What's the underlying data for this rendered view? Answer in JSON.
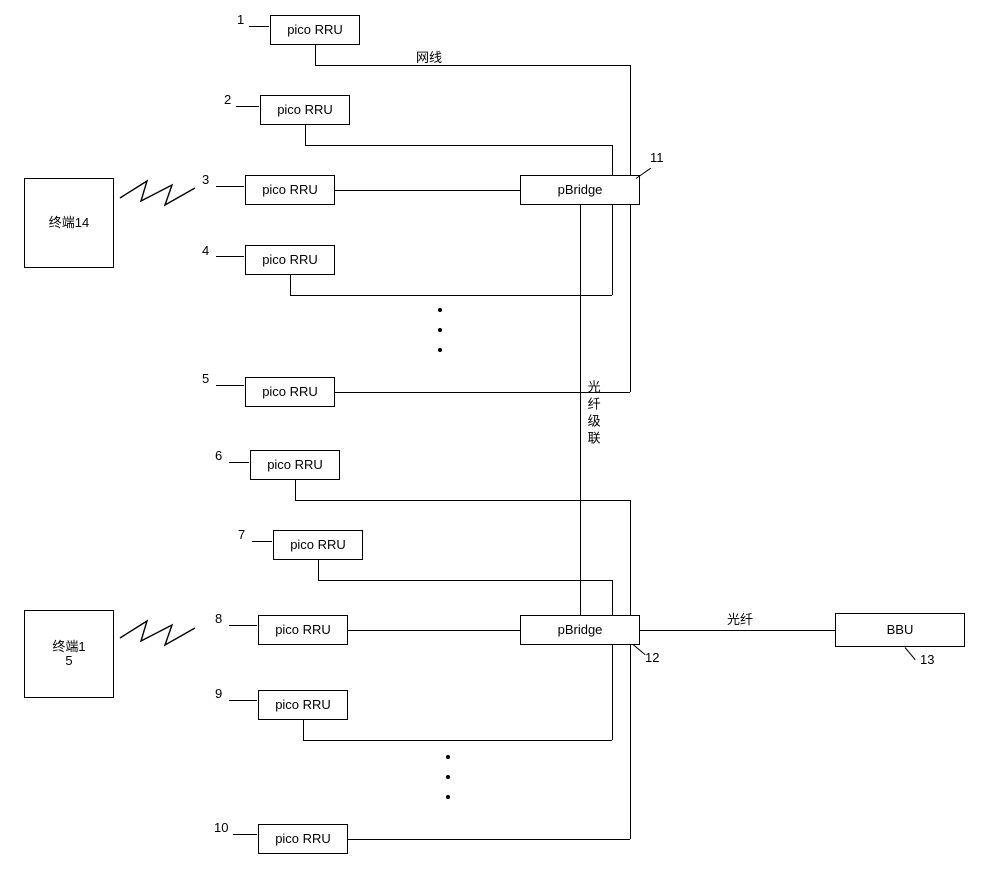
{
  "rrus": {
    "r1": {
      "n": "1",
      "label": "pico RRU"
    },
    "r2": {
      "n": "2",
      "label": "pico RRU"
    },
    "r3": {
      "n": "3",
      "label": "pico RRU"
    },
    "r4": {
      "n": "4",
      "label": "pico RRU"
    },
    "r5": {
      "n": "5",
      "label": "pico RRU"
    },
    "r6": {
      "n": "6",
      "label": "pico RRU"
    },
    "r7": {
      "n": "7",
      "label": "pico RRU"
    },
    "r8": {
      "n": "8",
      "label": "pico RRU"
    },
    "r9": {
      "n": "9",
      "label": "pico RRU"
    },
    "r10": {
      "n": "10",
      "label": "pico RRU"
    }
  },
  "bridges": {
    "b11": {
      "n": "11",
      "label": "pBridge"
    },
    "b12": {
      "n": "12",
      "label": "pBridge"
    }
  },
  "bbu": {
    "n": "13",
    "label": "BBU"
  },
  "terminals": {
    "t14": {
      "label": "终端14"
    },
    "t15": {
      "label_l1": "终端1",
      "label_l2": "5"
    }
  },
  "cables": {
    "eth": "网线",
    "fiber": "光纤",
    "fiber_cascade": "光纤级联"
  },
  "chart_data": {
    "type": "diagram-network",
    "desc": "Distributed pico-RRU architecture: two pBridges, each aggregating multiple pico-RRUs via Ethernet; bridges daisy-chained by fiber to a BBU; two wireless terminals.",
    "nodes": [
      {
        "id": "1",
        "type": "pico RRU"
      },
      {
        "id": "2",
        "type": "pico RRU"
      },
      {
        "id": "3",
        "type": "pico RRU"
      },
      {
        "id": "4",
        "type": "pico RRU"
      },
      {
        "id": "5",
        "type": "pico RRU",
        "note": "…more RRUs implied above"
      },
      {
        "id": "6",
        "type": "pico RRU"
      },
      {
        "id": "7",
        "type": "pico RRU"
      },
      {
        "id": "8",
        "type": "pico RRU"
      },
      {
        "id": "9",
        "type": "pico RRU"
      },
      {
        "id": "10",
        "type": "pico RRU",
        "note": "…more RRUs implied above"
      },
      {
        "id": "11",
        "type": "pBridge"
      },
      {
        "id": "12",
        "type": "pBridge"
      },
      {
        "id": "13",
        "type": "BBU"
      },
      {
        "id": "14",
        "type": "terminal",
        "label": "终端14"
      },
      {
        "id": "15",
        "type": "terminal",
        "label": "终端15"
      }
    ],
    "edges": [
      {
        "from": "1",
        "to": "11",
        "medium": "网线"
      },
      {
        "from": "2",
        "to": "11",
        "medium": "网线"
      },
      {
        "from": "3",
        "to": "11",
        "medium": "网线"
      },
      {
        "from": "4",
        "to": "11",
        "medium": "网线"
      },
      {
        "from": "5",
        "to": "11",
        "medium": "网线"
      },
      {
        "from": "6",
        "to": "12",
        "medium": "网线"
      },
      {
        "from": "7",
        "to": "12",
        "medium": "网线"
      },
      {
        "from": "8",
        "to": "12",
        "medium": "网线"
      },
      {
        "from": "9",
        "to": "12",
        "medium": "网线"
      },
      {
        "from": "10",
        "to": "12",
        "medium": "网线"
      },
      {
        "from": "11",
        "to": "12",
        "medium": "光纤级联"
      },
      {
        "from": "12",
        "to": "13",
        "medium": "光纤"
      },
      {
        "from": "14",
        "to": "3",
        "medium": "wireless"
      },
      {
        "from": "15",
        "to": "8",
        "medium": "wireless"
      }
    ]
  }
}
